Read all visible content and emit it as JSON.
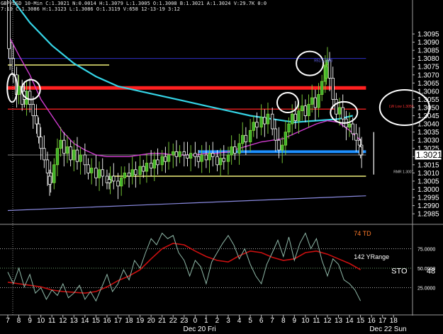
{
  "header": {
    "line1": "GBP/USD 10-Min  C:1.3021  N:0.0014  H:1.3079  L:1.3005  O:1.3008  B:1.3021  A:1.3024  V:29.7K  0:0",
    "line2": "7:10  C:1.3086  H:1.3123  L:1.3086  O:1.3119  V:658  12-13-19  3:12"
  },
  "chart_data": {
    "type": "candlestick",
    "price_axis": {
      "ylim": [
        1.2979,
        1.3108
      ],
      "ticks": [
        "1.3095",
        "1.3090",
        "1.3085",
        "1.3080",
        "1.3075",
        "1.3070",
        "1.3065",
        "1.3060",
        "1.3055",
        "1.3050",
        "1.3045",
        "1.3040",
        "1.3035",
        "1.3030",
        "1.3025",
        "1.3020",
        "1.3015",
        "1.3010",
        "1.3005",
        "1.3000",
        "1.2995",
        "1.2990",
        "1.2985"
      ],
      "last_price": "1.3021"
    },
    "time_axis": {
      "hours": [
        "7",
        "8",
        "9",
        "10",
        "11",
        "12",
        "13",
        "14",
        "15",
        "16",
        "17",
        "18",
        "19",
        "20",
        "21",
        "22",
        "23",
        "0",
        "1",
        "2",
        "3",
        "4",
        "5",
        "6",
        "7",
        "8",
        "9",
        "10",
        "11",
        "12",
        "13",
        "14",
        "15",
        "16",
        "17",
        "18"
      ],
      "dates": [
        "Dec 20 Fri",
        "Dec 22 Sun"
      ]
    },
    "close_path": [
      [
        7.0,
        1.309
      ],
      [
        7.2,
        1.308
      ],
      [
        7.5,
        1.307
      ],
      [
        7.8,
        1.3058
      ],
      [
        8.0,
        1.3063
      ],
      [
        8.3,
        1.3052
      ],
      [
        8.7,
        1.306
      ],
      [
        9.0,
        1.3052
      ],
      [
        9.3,
        1.3045
      ],
      [
        9.6,
        1.304
      ],
      [
        9.8,
        1.3032
      ],
      [
        10.0,
        1.3025
      ],
      [
        10.3,
        1.3018
      ],
      [
        10.6,
        1.301
      ],
      [
        10.9,
        1.3004
      ],
      [
        11.2,
        1.3015
      ],
      [
        11.5,
        1.3025
      ],
      [
        11.8,
        1.303
      ],
      [
        12.1,
        1.3022
      ],
      [
        12.4,
        1.3026
      ],
      [
        12.7,
        1.3018
      ],
      [
        13.0,
        1.3024
      ],
      [
        13.3,
        1.3017
      ],
      [
        13.6,
        1.3021
      ],
      [
        14.0,
        1.3015
      ],
      [
        14.3,
        1.301
      ],
      [
        14.6,
        1.3013
      ],
      [
        15.0,
        1.3007
      ],
      [
        15.3,
        1.3012
      ],
      [
        15.6,
        1.3008
      ],
      [
        16.0,
        1.3004
      ],
      [
        16.3,
        1.3008
      ],
      [
        16.6,
        1.3005
      ],
      [
        17.0,
        1.3002
      ],
      [
        17.3,
        1.3007
      ],
      [
        17.6,
        1.301
      ],
      [
        18.0,
        1.3008
      ],
      [
        18.3,
        1.3012
      ],
      [
        18.6,
        1.3009
      ],
      [
        19.0,
        1.3014
      ],
      [
        19.3,
        1.3011
      ],
      [
        19.6,
        1.3016
      ],
      [
        20.0,
        1.3013
      ],
      [
        20.3,
        1.3018
      ],
      [
        20.6,
        1.3015
      ],
      [
        21.0,
        1.302
      ],
      [
        21.3,
        1.3017
      ],
      [
        21.6,
        1.3021
      ],
      [
        22.0,
        1.3023
      ],
      [
        22.3,
        1.302
      ],
      [
        22.6,
        1.3023
      ],
      [
        23.0,
        1.3021
      ],
      [
        23.3,
        1.3019
      ],
      [
        23.6,
        1.3022
      ],
      [
        24.0,
        1.302
      ],
      [
        24.3,
        1.3017
      ],
      [
        24.6,
        1.3021
      ],
      [
        25.0,
        1.3018
      ],
      [
        25.3,
        1.3022
      ],
      [
        25.6,
        1.302
      ],
      [
        26.0,
        1.3015
      ],
      [
        26.3,
        1.3019
      ],
      [
        26.6,
        1.3017
      ],
      [
        27.0,
        1.3021
      ],
      [
        27.3,
        1.3026
      ],
      [
        27.6,
        1.3022
      ],
      [
        28.0,
        1.3028
      ],
      [
        28.3,
        1.3033
      ],
      [
        28.6,
        1.3029
      ],
      [
        29.0,
        1.3036
      ],
      [
        29.3,
        1.3041
      ],
      [
        29.6,
        1.3038
      ],
      [
        30.0,
        1.3044
      ],
      [
        30.3,
        1.304
      ],
      [
        30.6,
        1.3046
      ],
      [
        31.0,
        1.3037
      ],
      [
        31.3,
        1.303
      ],
      [
        31.6,
        1.3024
      ],
      [
        31.9,
        1.3027
      ],
      [
        32.2,
        1.3035
      ],
      [
        32.5,
        1.304
      ],
      [
        32.8,
        1.3046
      ],
      [
        33.1,
        1.3042
      ],
      [
        33.4,
        1.3048
      ],
      [
        33.7,
        1.3051
      ],
      [
        34.0,
        1.3045
      ],
      [
        34.3,
        1.3052
      ],
      [
        34.6,
        1.3056
      ],
      [
        34.9,
        1.305
      ],
      [
        35.2,
        1.3058
      ],
      [
        35.5,
        1.3066
      ],
      [
        35.8,
        1.3076
      ],
      [
        36.0,
        1.3079
      ],
      [
        36.2,
        1.3068
      ],
      [
        36.5,
        1.3055
      ],
      [
        36.8,
        1.3046
      ],
      [
        37.1,
        1.305
      ],
      [
        37.4,
        1.3043
      ],
      [
        37.7,
        1.3038
      ],
      [
        38.0,
        1.304
      ],
      [
        38.3,
        1.3034
      ],
      [
        38.6,
        1.303
      ],
      [
        38.9,
        1.3027
      ],
      [
        39.1,
        1.3021
      ]
    ],
    "candles": [
      {
        "x": 7.1,
        "o": 1.3119,
        "h": 1.3123,
        "l": 1.308,
        "c": 1.3086
      },
      {
        "x": 8.5,
        "o": 1.306,
        "h": 1.3066,
        "l": 1.305,
        "c": 1.3055
      },
      {
        "x": 10.8,
        "o": 1.3008,
        "h": 1.3012,
        "l": 1.2996,
        "c": 1.3003
      },
      {
        "x": 16.2,
        "o": 1.3006,
        "h": 1.301,
        "l": 1.3,
        "c": 1.3004
      },
      {
        "x": 35.9,
        "o": 1.3068,
        "h": 1.3079,
        "l": 1.3064,
        "c": 1.3075
      },
      {
        "x": 39.0,
        "o": 1.3026,
        "h": 1.3031,
        "l": 1.3019,
        "c": 1.3021
      }
    ],
    "moving_averages": [
      {
        "color": "#35d4e6",
        "points": [
          [
            7,
            1.312
          ],
          [
            9,
            1.3102
          ],
          [
            11,
            1.3088
          ],
          [
            13,
            1.3077
          ],
          [
            15,
            1.3069
          ],
          [
            17,
            1.3063
          ],
          [
            19,
            1.306
          ],
          [
            21,
            1.3057
          ],
          [
            23,
            1.3054
          ],
          [
            25,
            1.3051
          ],
          [
            27,
            1.3048
          ],
          [
            29,
            1.3045
          ],
          [
            31,
            1.3043
          ],
          [
            33,
            1.3041
          ],
          [
            35,
            1.3042
          ],
          [
            37,
            1.3043
          ],
          [
            38.3,
            1.3045
          ]
        ]
      },
      {
        "color": "#d23cd2",
        "points": [
          [
            7,
            1.3095
          ],
          [
            8,
            1.3082
          ],
          [
            9,
            1.307
          ],
          [
            10,
            1.3055
          ],
          [
            11,
            1.3045
          ],
          [
            12,
            1.3035
          ],
          [
            13,
            1.3028
          ],
          [
            14,
            1.3024
          ],
          [
            15,
            1.3021
          ],
          [
            16,
            1.302
          ],
          [
            17,
            1.302
          ],
          [
            18,
            1.302
          ],
          [
            19,
            1.3021
          ],
          [
            20,
            1.3022
          ],
          [
            21,
            1.3022
          ],
          [
            22,
            1.3021
          ],
          [
            23,
            1.3021
          ],
          [
            24,
            1.3021
          ],
          [
            25,
            1.3022
          ],
          [
            26,
            1.3022
          ],
          [
            27,
            1.3023
          ],
          [
            28,
            1.3025
          ],
          [
            29,
            1.3027
          ],
          [
            30,
            1.3029
          ],
          [
            31,
            1.303
          ],
          [
            32,
            1.3031
          ],
          [
            33,
            1.3034
          ],
          [
            34,
            1.3037
          ],
          [
            35,
            1.304
          ],
          [
            36,
            1.3042
          ],
          [
            37,
            1.3041
          ],
          [
            38,
            1.3036
          ],
          [
            39,
            1.303
          ]
        ]
      }
    ],
    "levels": [
      {
        "y": 1.3062,
        "x1": 7,
        "x2": 39.5,
        "color": "#ff2020",
        "width": 5
      },
      {
        "y": 1.3049,
        "x1": 7,
        "x2": 39.5,
        "color": "#d81c1c",
        "width": 1.5
      },
      {
        "y": 1.3076,
        "x1": 7,
        "x2": 16.2,
        "color": "#f0f07a",
        "width": 1.5
      },
      {
        "y": 1.308,
        "x1": 7,
        "x2": 39.5,
        "color": "#3030c8",
        "width": 1
      },
      {
        "y": 1.3023,
        "x1": 24.3,
        "x2": 39.5,
        "color": "#1e90ff",
        "width": 4
      },
      {
        "y": 1.3008,
        "x1": 16.5,
        "x2": 39.5,
        "color": "#f0f07a",
        "width": 1.5
      },
      {
        "y": 1.3021,
        "x1": 7,
        "x2": 39.5,
        "color": "#808080",
        "width": 1
      }
    ],
    "trend_line": {
      "color": "#8a8ae0",
      "points": [
        [
          7,
          1.2987
        ],
        [
          39.5,
          1.2996
        ]
      ]
    },
    "vertical_marker": {
      "x": 40.2,
      "y1": 1.3035,
      "y2": 1.3009,
      "color": "#ffffff"
    },
    "ellipses": [
      {
        "x": 7.4,
        "y": 1.3062,
        "w": 14,
        "h": 40
      },
      {
        "x": 9.1,
        "y": 1.3061,
        "w": 26,
        "h": 28
      },
      {
        "x": 34.4,
        "y": 1.3077,
        "w": 38,
        "h": 34
      },
      {
        "x": 32.4,
        "y": 1.3053,
        "w": 30,
        "h": 28
      },
      {
        "x": 37.5,
        "y": 1.3047,
        "w": 38,
        "h": 30
      },
      {
        "x": 43.0,
        "y": 1.305,
        "w": 70,
        "h": 50
      }
    ],
    "annotations": [
      {
        "text": "R51 1.3080",
        "x": 34.8,
        "y": 1.3078,
        "cls": "ann-s",
        "color": "#6a6aff"
      },
      {
        "text": "LW Low 1.3050",
        "x": 41.6,
        "y": 1.305,
        "cls": "ann-s",
        "color": "#ff3030"
      },
      {
        "text": "RMR 1.3007",
        "x": 42.0,
        "y": 1.301,
        "cls": "ann-s",
        "color": "#d0d0d0"
      }
    ],
    "oscillator": {
      "ylim": [
        0,
        100
      ],
      "ticks": [
        "75.0000",
        "50.0000",
        "25.0000"
      ],
      "levels": [
        {
          "y": 75,
          "color": "#e0e0e0"
        },
        {
          "y": 50,
          "color": "#8fd68f"
        },
        {
          "y": 25,
          "color": "#e0e0e0"
        }
      ],
      "labels": [
        {
          "text": "74 TD",
          "x": 38.4,
          "y": 92,
          "cls": "ann-m",
          "color": "#ff7a2a"
        },
        {
          "text": "142 YRange",
          "x": 38.4,
          "y": 62,
          "cls": "ann-m",
          "color": "#ffffff"
        },
        {
          "text": "STO",
          "x": 41.8,
          "y": 43,
          "cls": "ann-l",
          "color": "#ffffff"
        },
        {
          "text": "48",
          "x": 45.0,
          "y": 43,
          "cls": "ann-l",
          "color": "#ffffff"
        }
      ],
      "series": [
        {
          "color": "#cc1010",
          "points": [
            [
              7,
              32
            ],
            [
              8,
              30
            ],
            [
              9,
              28
            ],
            [
              10,
              26
            ],
            [
              11,
              22
            ],
            [
              12,
              20
            ],
            [
              13,
              19
            ],
            [
              14,
              18
            ],
            [
              15,
              20
            ],
            [
              16,
              26
            ],
            [
              17,
              34
            ],
            [
              18,
              40
            ],
            [
              19,
              48
            ],
            [
              20,
              62
            ],
            [
              21,
              75
            ],
            [
              22,
              82
            ],
            [
              23,
              80
            ],
            [
              24,
              72
            ],
            [
              25,
              65
            ],
            [
              26,
              60
            ],
            [
              27,
              58
            ],
            [
              28,
              66
            ],
            [
              29,
              72
            ],
            [
              30,
              70
            ],
            [
              31,
              64
            ],
            [
              32,
              60
            ],
            [
              33,
              62
            ],
            [
              34,
              70
            ],
            [
              35,
              72
            ],
            [
              36,
              68
            ],
            [
              37,
              62
            ],
            [
              38,
              56
            ],
            [
              39,
              48
            ]
          ]
        },
        {
          "color": "#8fb8a8",
          "points": [
            [
              7,
              45
            ],
            [
              7.5,
              30
            ],
            [
              8,
              50
            ],
            [
              8.5,
              26
            ],
            [
              9,
              42
            ],
            [
              9.5,
              18
            ],
            [
              10,
              25
            ],
            [
              10.5,
              10
            ],
            [
              11,
              22
            ],
            [
              11.5,
              15
            ],
            [
              12,
              30
            ],
            [
              12.5,
              12
            ],
            [
              13,
              18
            ],
            [
              13.5,
              28
            ],
            [
              14,
              10
            ],
            [
              14.5,
              20
            ],
            [
              15,
              8
            ],
            [
              15.5,
              25
            ],
            [
              16,
              42
            ],
            [
              16.5,
              20
            ],
            [
              17,
              30
            ],
            [
              17.5,
              48
            ],
            [
              18,
              35
            ],
            [
              18.5,
              60
            ],
            [
              19,
              50
            ],
            [
              19.5,
              70
            ],
            [
              20,
              88
            ],
            [
              20.5,
              80
            ],
            [
              21,
              95
            ],
            [
              21.5,
              88
            ],
            [
              22,
              92
            ],
            [
              22.5,
              70
            ],
            [
              23,
              60
            ],
            [
              23.5,
              40
            ],
            [
              24,
              60
            ],
            [
              24.5,
              52
            ],
            [
              25,
              30
            ],
            [
              25.5,
              58
            ],
            [
              26,
              70
            ],
            [
              26.5,
              82
            ],
            [
              27,
              92
            ],
            [
              27.5,
              80
            ],
            [
              28,
              62
            ],
            [
              28.5,
              75
            ],
            [
              29,
              55
            ],
            [
              29.5,
              40
            ],
            [
              30,
              30
            ],
            [
              30.5,
              55
            ],
            [
              31,
              70
            ],
            [
              31.5,
              86
            ],
            [
              32,
              65
            ],
            [
              32.5,
              90
            ],
            [
              33,
              60
            ],
            [
              33.5,
              82
            ],
            [
              34,
              95
            ],
            [
              34.5,
              75
            ],
            [
              35,
              88
            ],
            [
              35.5,
              60
            ],
            [
              36,
              40
            ],
            [
              36.5,
              62
            ],
            [
              37,
              55
            ],
            [
              37.5,
              35
            ],
            [
              38,
              30
            ],
            [
              38.5,
              22
            ],
            [
              39,
              8
            ]
          ]
        }
      ]
    }
  }
}
